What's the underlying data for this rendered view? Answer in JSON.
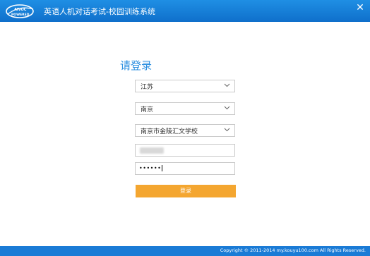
{
  "window": {
    "title": "英语人机对话考试-校园训练系统",
    "logo_text": "AIVOC POWERED",
    "close_glyph": "✕"
  },
  "login": {
    "heading": "请登录",
    "province": "江苏",
    "city": "南京",
    "school": "南京市金陵汇文学校",
    "password_mask": "••••••",
    "submit_label": "登录"
  },
  "footer": {
    "copyright": "Copyright © 2011-2014 my.kouyu100.com All Rights Reserved."
  },
  "colors": {
    "titlebar": "#1576d3",
    "accent_text": "#2a8ee0",
    "button": "#f4a630",
    "footer": "#1a7bd6"
  }
}
